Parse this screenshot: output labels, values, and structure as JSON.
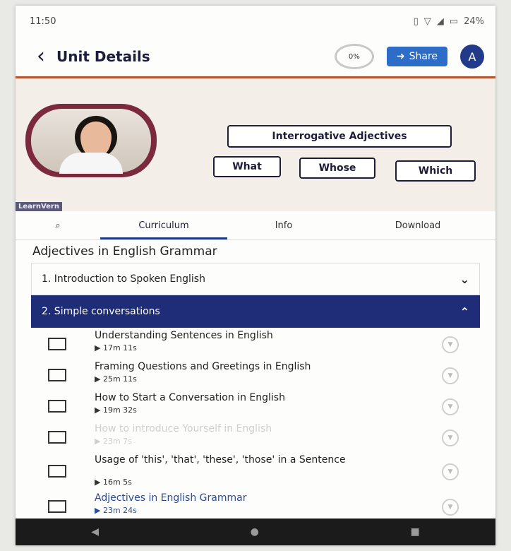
{
  "status": {
    "time": "11:50",
    "indicators": "24%"
  },
  "header": {
    "title": "Unit Details",
    "progress": "0%",
    "share_label": "Share",
    "avatar_letter": "A"
  },
  "banner": {
    "title_tag": "Interrogative Adjectives",
    "tags": [
      "What",
      "Whose",
      "Which"
    ],
    "watermark": "LearnVern"
  },
  "tabs": [
    "Curriculum",
    "Info",
    "Download"
  ],
  "course_title": "Adjectives in English Grammar",
  "sections": [
    {
      "label": "1. Introduction to Spoken English",
      "open": false
    },
    {
      "label": "2. Simple conversations",
      "open": true
    }
  ],
  "lessons": [
    {
      "title": "Understanding Sentences in English",
      "duration": "17m 11s"
    },
    {
      "title": "Framing Questions and Greetings in English",
      "duration": "25m 11s"
    },
    {
      "title": "How to Start a Conversation in English",
      "duration": "19m 32s"
    },
    {
      "title": "How to introduce Yourself in English",
      "duration": "23m 7s"
    },
    {
      "title": "Usage of 'this', 'that', 'these', 'those' in a Sentence",
      "duration": "16m 5s"
    },
    {
      "title": "Adjectives in English Grammar",
      "duration": "23m 24s"
    }
  ],
  "colors": {
    "primary": "#1f2d78",
    "share": "#2d6cc7",
    "accent_line": "#b8532e"
  }
}
